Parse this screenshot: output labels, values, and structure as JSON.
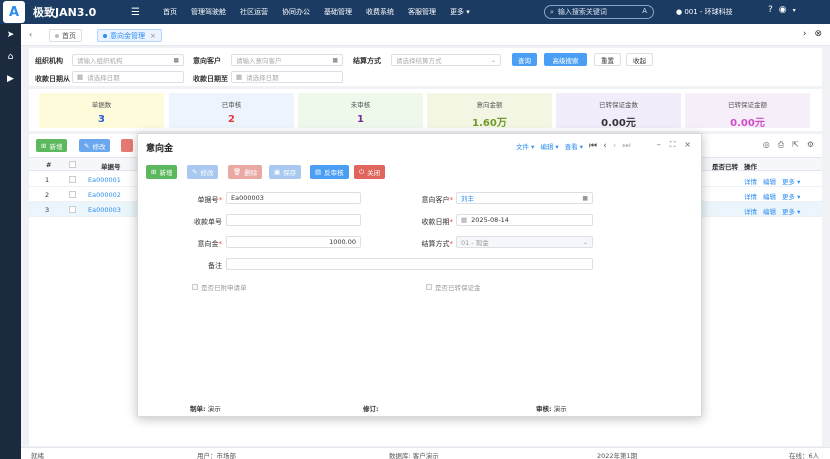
{
  "app": {
    "logo": "A",
    "title": "极致JAN3.0"
  },
  "nav": {
    "items": [
      "首页",
      "管理驾驶舱",
      "社区运营",
      "协同办公",
      "基础管理",
      "收费系统",
      "客服管理"
    ],
    "more": "更多 ▾",
    "search_placeholder": "输入搜索关键词",
    "search_key": "A",
    "company": "001 - 环球科技"
  },
  "tabs": [
    {
      "label": "首页"
    },
    {
      "label": "意向金管理",
      "active": true
    }
  ],
  "filter": {
    "org_label": "组织机构",
    "org_placeholder": "请输入组织机构",
    "customer_label": "意向客户",
    "customer_placeholder": "请输入意向客户",
    "settle_label": "结算方式",
    "settle_placeholder": "请选择结算方式",
    "date_from_label": "收款日期从",
    "date_from_placeholder": "请选择日期",
    "date_to_label": "收款日期至",
    "date_to_placeholder": "请选择日期",
    "query": "查询",
    "advanced": "高级搜索",
    "reset": "重置",
    "collapse": "收起"
  },
  "stats": [
    {
      "title": "单据数",
      "value": "3",
      "bg": "#fdfbd9",
      "color": "#2d5bd7"
    },
    {
      "title": "已审核",
      "value": "2",
      "bg": "#eef4fd",
      "color": "#e23b3b"
    },
    {
      "title": "未审核",
      "value": "1",
      "bg": "#eef9ec",
      "color": "#7a2c9a"
    },
    {
      "title": "意向金额",
      "value": "1.60万",
      "bg": "#f4f6e4",
      "color": "#6f9a2a"
    },
    {
      "title": "已转保证金数",
      "value": "0.00元",
      "bg": "#f3edfb",
      "color": "#333333"
    },
    {
      "title": "已转保证金额",
      "value": "0.00元",
      "bg": "#f6eff9",
      "color": "#d04cc6"
    }
  ],
  "table": {
    "toolbar": {
      "add": "新增",
      "edit": "修改"
    },
    "headers": {
      "index": "#",
      "bill_no": "单据号",
      "transferred": "是否已转",
      "actions": "操作"
    },
    "rows": [
      {
        "index": "1",
        "bill_no": "Ea000001"
      },
      {
        "index": "2",
        "bill_no": "Ea000002"
      },
      {
        "index": "3",
        "bill_no": "Ea000003"
      }
    ],
    "row_actions": {
      "detail": "详情",
      "edit": "编辑",
      "more": "更多 ▾"
    }
  },
  "dialog": {
    "title": "意向金",
    "tools": {
      "file": "文件 ▾",
      "edit": "编辑 ▾",
      "view": "查看 ▾"
    },
    "buttons": {
      "add": "新增",
      "edit": "修改",
      "delete": "删除",
      "save": "保存",
      "unaudit": "反审核",
      "close": "关闭"
    },
    "fields": {
      "bill_no_label": "单据号",
      "bill_no_value": "Ea000003",
      "customer_label": "意向客户",
      "customer_value": "刘丰",
      "receipt_no_label": "收款单号",
      "receipt_no_value": "",
      "receipt_date_label": "收款日期",
      "receipt_date_value": "2025-08-14",
      "amount_label": "意向金",
      "amount_value": "1000.00",
      "settle_label": "结算方式",
      "settle_value": "01 - 现金",
      "remark_label": "备注",
      "remark_value": ""
    },
    "checks": {
      "apply": "是否已附申请单",
      "transferred": "是否已转保证金"
    },
    "footer": {
      "creator_label": "制单:",
      "creator": "演示",
      "modifier_label": "修订:",
      "modifier": "",
      "auditor_label": "审核:",
      "auditor": "演示"
    }
  },
  "status": {
    "ready": "就绪",
    "user": "用户：市场部",
    "db": "数据库: 客户演示",
    "period": "2022年第1期",
    "online": "在线：6人"
  }
}
